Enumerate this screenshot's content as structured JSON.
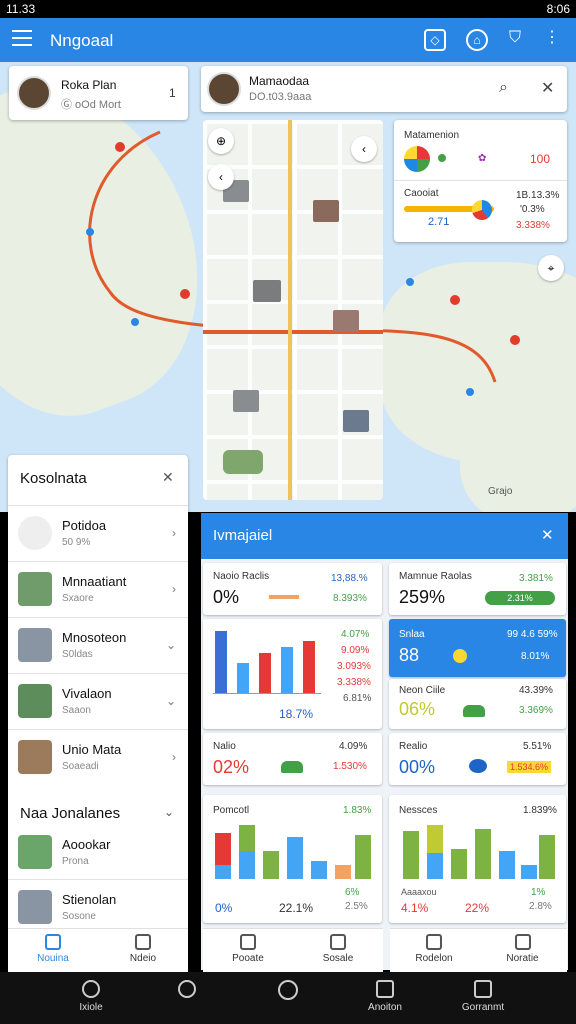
{
  "status_bar": {
    "time": "11.33",
    "right_time": "8:06"
  },
  "app_bar": {
    "title": "Nngoaal",
    "menu_icon": "hamburger-menu-icon",
    "actions": [
      {
        "icon": "image-icon"
      },
      {
        "icon": "home-icon"
      },
      {
        "icon": "shield-icon"
      },
      {
        "icon": "more-vert-icon"
      }
    ]
  },
  "map": {
    "user_card": {
      "name": "Roka Plan",
      "sub": "Ⓖ oOd Mort",
      "count": "1"
    },
    "search_card": {
      "title": "Mamaodaa",
      "sub": "DO.t03.9aaa"
    },
    "attribution": "Grajo",
    "stats_card": {
      "top_label": "Matamenion",
      "top_value": "100",
      "bottom_label": "Caooiat",
      "bottom_value1": "1B.13.3%",
      "bottom_value2": "'0.3%",
      "bottom_value3": "3.338%",
      "inline_value": "2.71"
    }
  },
  "left_panel": {
    "title": "Kosolnata",
    "items": [
      {
        "title": "Potidoa",
        "sub": "50 9%"
      },
      {
        "title": "Mnnaatiant",
        "sub": "Sxaore"
      },
      {
        "title": "Mnosoteon",
        "sub": "S0ldas"
      },
      {
        "title": "Vivalaon",
        "sub": "Saaon"
      },
      {
        "title": "Unio Mata",
        "sub": "Soaeadi"
      }
    ],
    "section_title": "Naa Jonalanes",
    "section_items": [
      {
        "title": "Aoookar",
        "sub": "Prona"
      },
      {
        "title": "Stienolan",
        "sub": "Sosone"
      }
    ],
    "tabs": [
      {
        "label": "Nouina",
        "icon": "bank-icon"
      },
      {
        "label": "Ndeio",
        "icon": "phone-icon"
      }
    ]
  },
  "dashboard": {
    "title": "Ivmajaiel",
    "c1": {
      "label": "Naoio Raclis",
      "value": "0%",
      "stat1": "13,88.%",
      "stat2": "8.393%"
    },
    "c2": {
      "label": "Mamnue Raolas",
      "value": "259%",
      "stat1": "3.381%",
      "badge": "2.31%"
    },
    "c3": {
      "label": "Snlaa",
      "value": "88",
      "stat1": "99 4.6 59%",
      "stat2": "8.01%"
    },
    "bar1": {
      "stats": [
        "4.07%",
        "9.09%",
        "3.093%",
        "3.338%",
        "6.81%"
      ],
      "foot": "18.7%"
    },
    "c4": {
      "label": "Neon Ciile",
      "value": "06%",
      "stat1": "43.39%",
      "stat2": "3.369%"
    },
    "c5": {
      "label": "Nalio",
      "value": "02%",
      "stat1": "4.09%",
      "stat2": "1.530%"
    },
    "c6": {
      "label": "Realio",
      "value": "00%",
      "stat1": "5.51%",
      "badge": "1.534.6%"
    },
    "bar2": {
      "label": "Pomcotl",
      "stat": "1.83%",
      "foot1": "0%",
      "foot2": "22.1%",
      "foot3": "2.5%",
      "mid": "6%"
    },
    "bar3": {
      "label": "Nessces",
      "stat": "1.839%",
      "foot1": "4.1%",
      "foot2": "22%",
      "foot3": "2.8%",
      "mid": "1%",
      "sub": "Aaaaxou"
    },
    "tabs": [
      {
        "label": "Pooate",
        "icon": "pen-icon"
      },
      {
        "label": "Sosale",
        "icon": "hand-icon"
      },
      {
        "label": "Rodelon",
        "icon": "box-icon"
      },
      {
        "label": "Noratie",
        "icon": "chart-icon"
      }
    ]
  },
  "bottom_nav": [
    {
      "label": "Ixiole",
      "icon": "person-group-icon"
    },
    {
      "label": "",
      "icon": "search-icon"
    },
    {
      "label": "",
      "icon": "home-circle-icon"
    },
    {
      "label": "Anoiton",
      "icon": "recent-apps-icon"
    },
    {
      "label": "Gorranmt",
      "icon": "chat-icon"
    }
  ]
}
